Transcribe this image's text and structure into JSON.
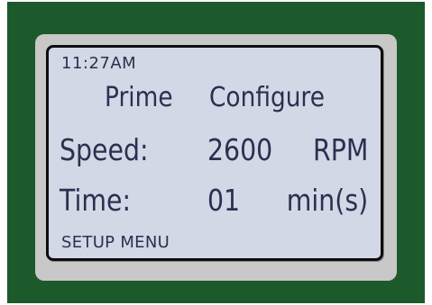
{
  "display": {
    "time": "11:27AM",
    "title_left": "Prime",
    "title_right": "Configure",
    "rows": [
      {
        "label": "Speed:",
        "value": "2600",
        "unit": "RPM"
      },
      {
        "label": "Time:",
        "value": "01",
        "unit": "min(s)"
      }
    ],
    "footer": "SETUP MENU"
  },
  "colors": {
    "panel": "#1c5a2b",
    "bezel": "#c8c8c8",
    "lcd_background": "#d3d8e6",
    "lcd_text": "#2a3150"
  }
}
